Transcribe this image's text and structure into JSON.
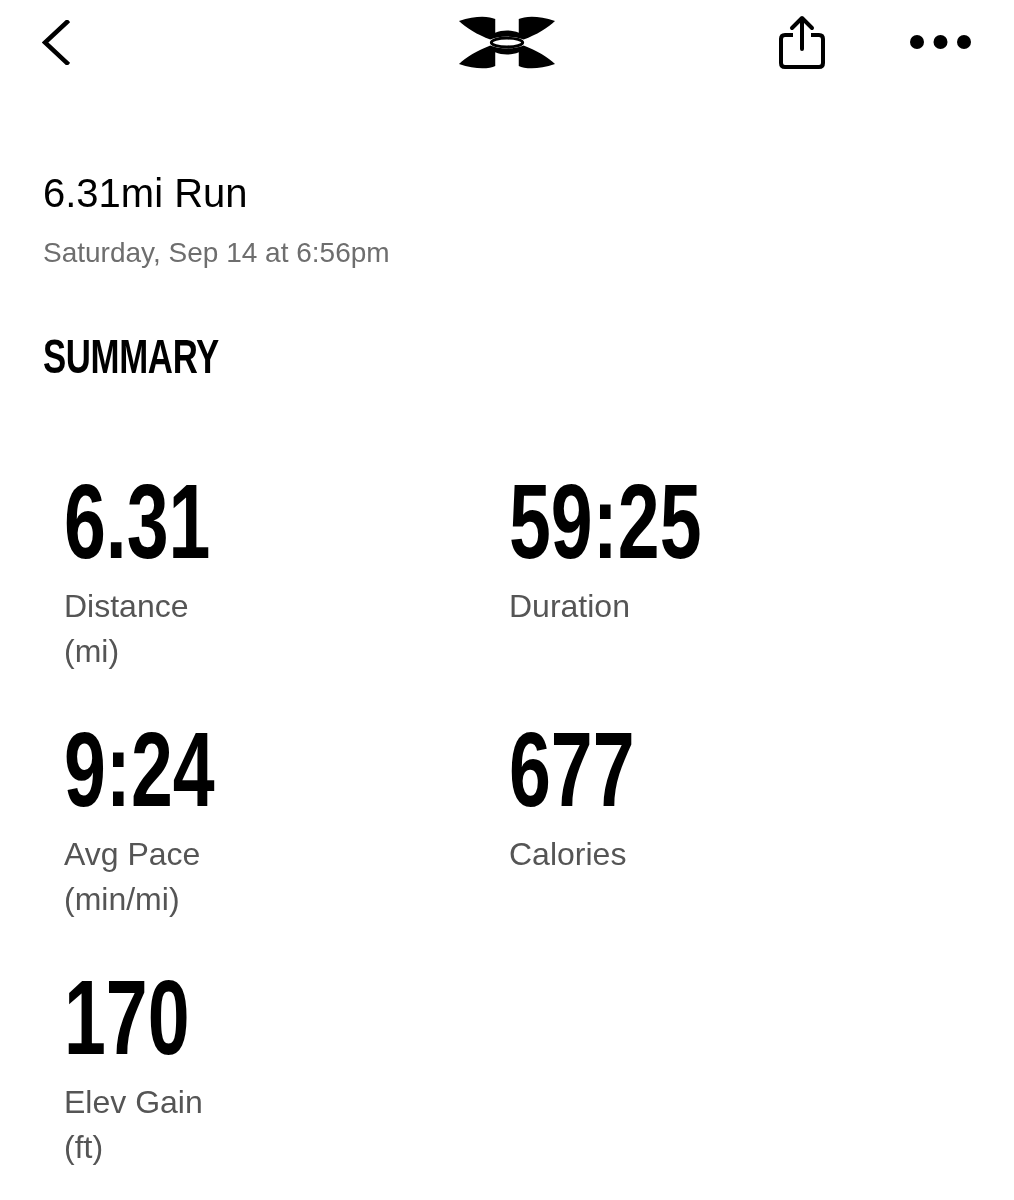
{
  "activity": {
    "title": "6.31mi Run",
    "datetime": "Saturday, Sep 14 at 6:56pm"
  },
  "summary": {
    "heading": "SUMMARY",
    "stats": [
      {
        "value": "6.31",
        "label": "Distance",
        "unit": "(mi)"
      },
      {
        "value": "59:25",
        "label": "Duration"
      },
      {
        "value": "9:24",
        "label": "Avg Pace",
        "unit": "(min/mi)"
      },
      {
        "value": "677",
        "label": "Calories"
      },
      {
        "value": "170",
        "label": "Elev Gain",
        "unit": "(ft)"
      }
    ]
  }
}
